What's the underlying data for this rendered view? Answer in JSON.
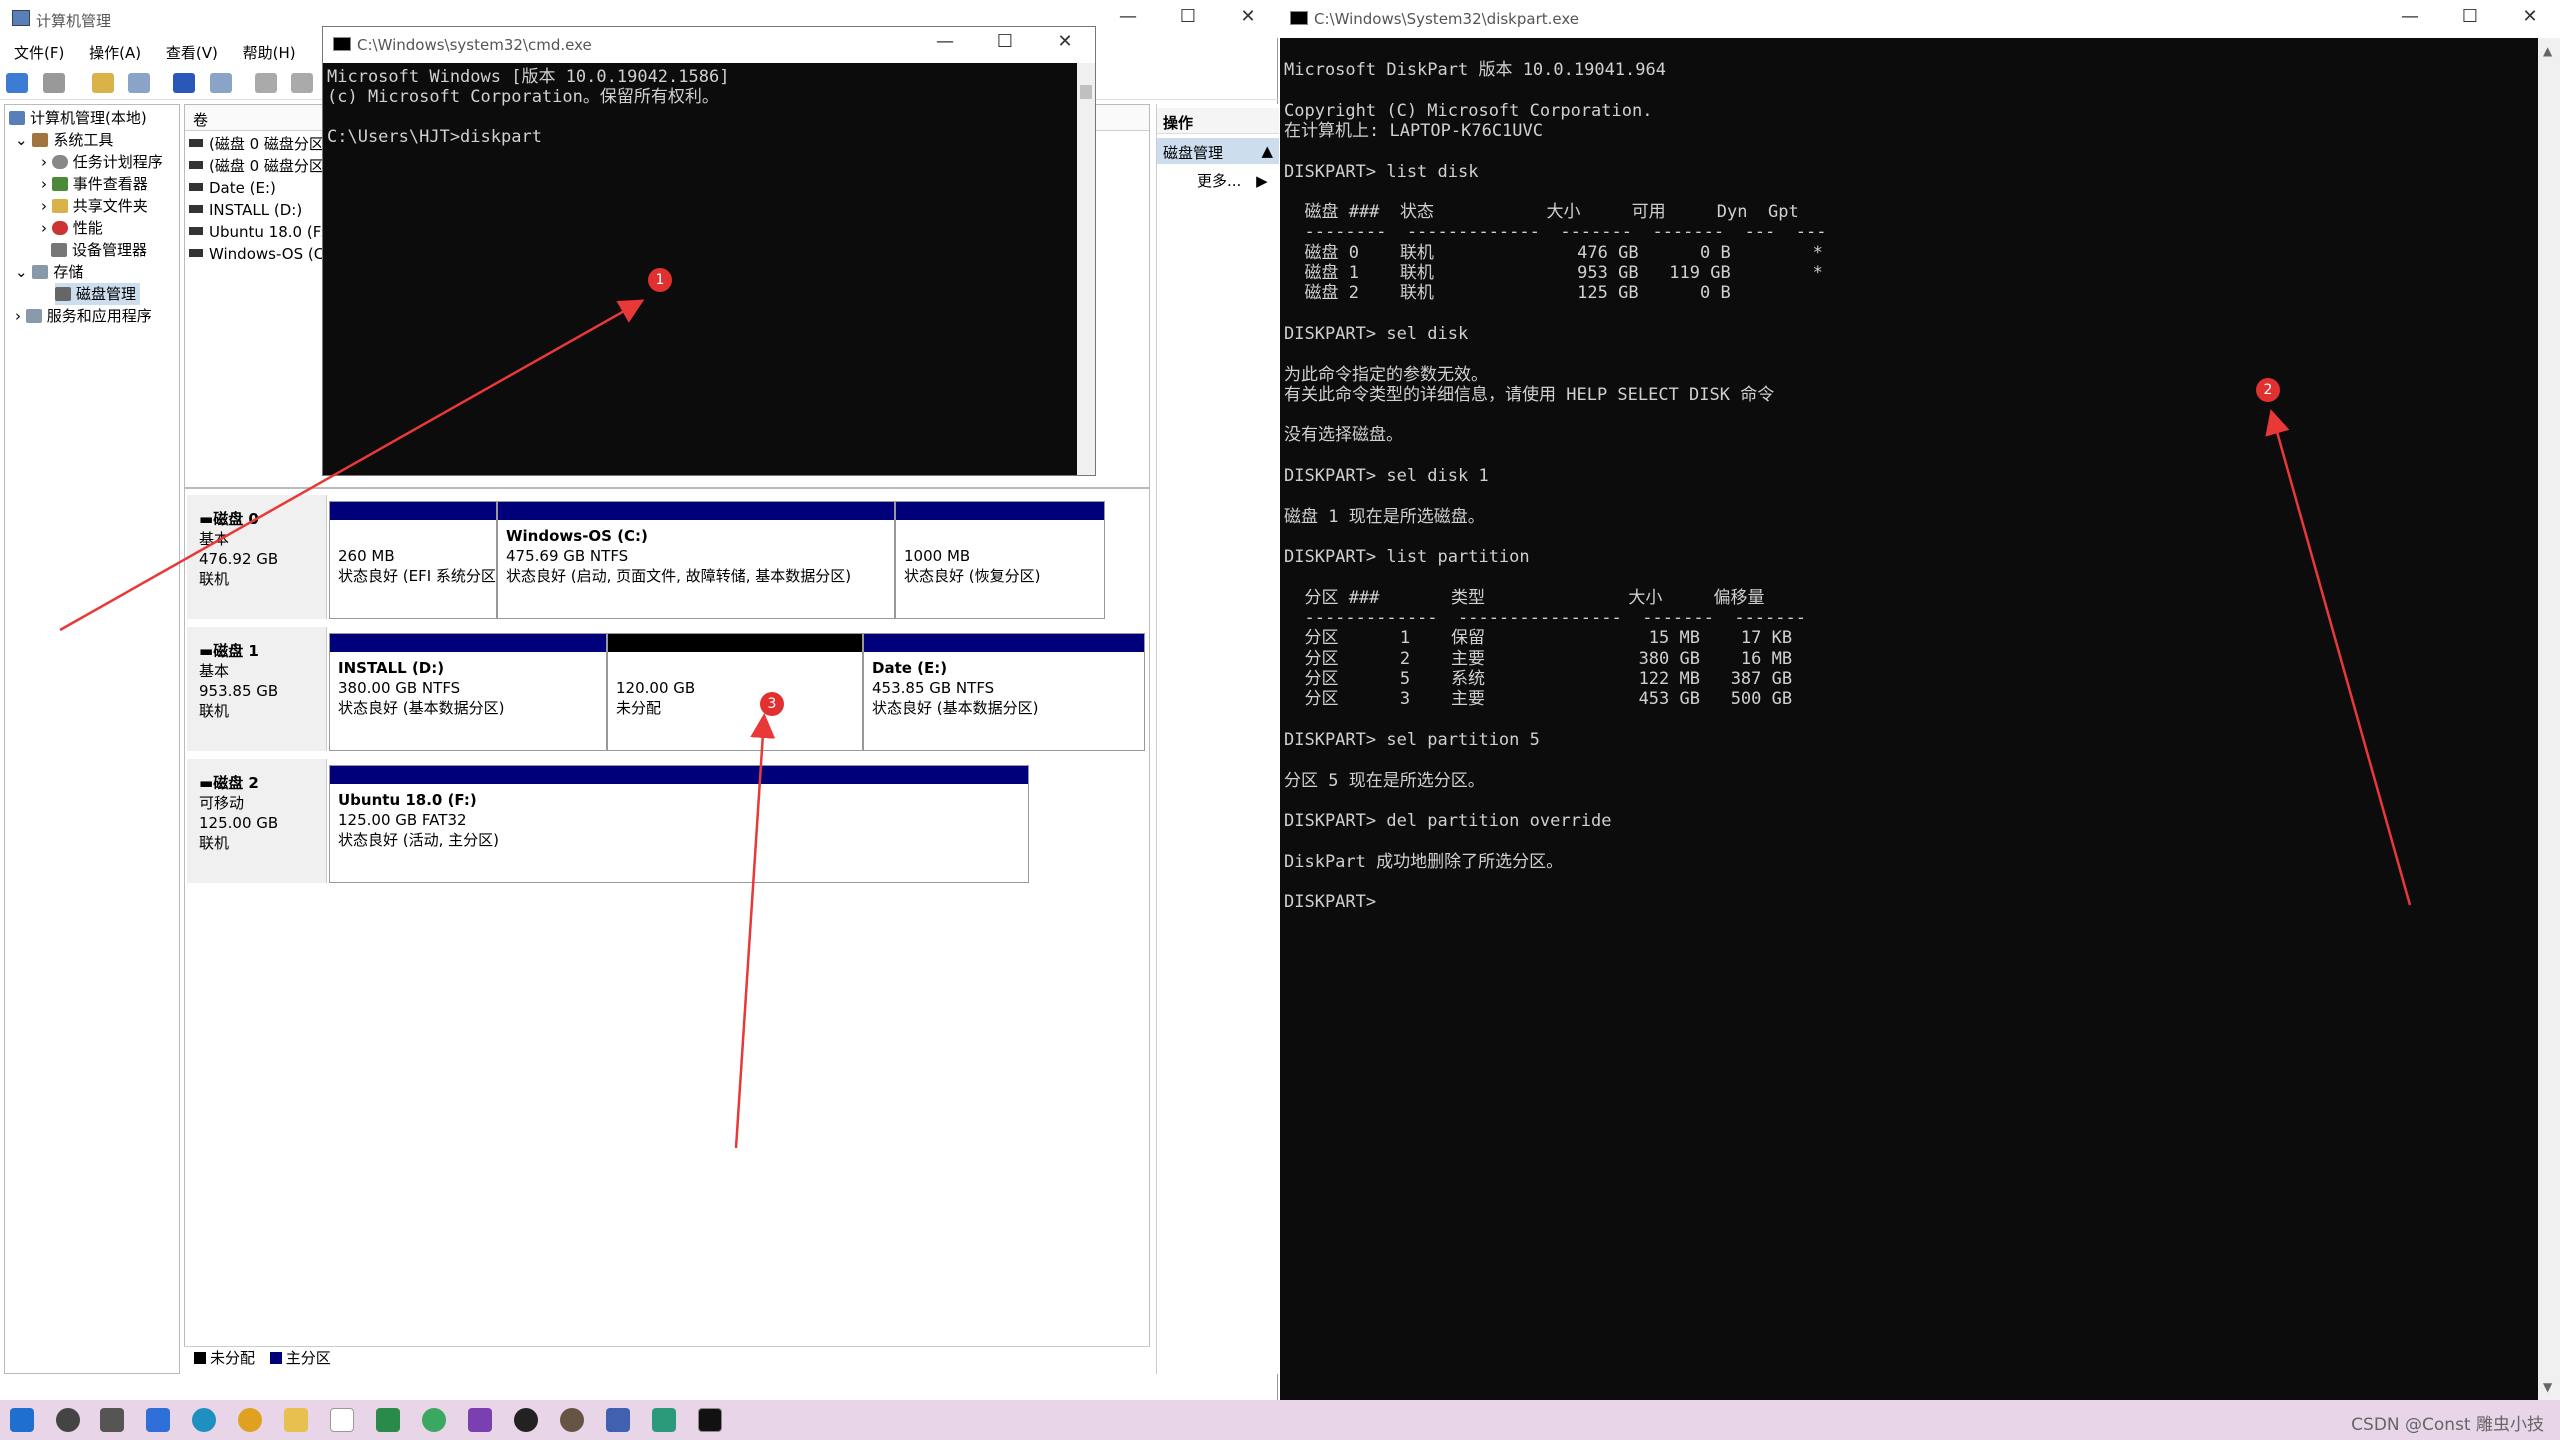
{
  "comp_mgmt": {
    "title": "计算机管理",
    "menu": [
      "文件(F)",
      "操作(A)",
      "查看(V)",
      "帮助(H)"
    ],
    "tree": [
      "计算机管理(本地)",
      "系统工具",
      "任务计划程序",
      "事件查看器",
      "共享文件夹",
      "性能",
      "设备管理器",
      "存储",
      "磁盘管理",
      "服务和应用程序"
    ],
    "vol_header": "卷",
    "volumes": [
      "(磁盘 0 磁盘分区",
      "(磁盘 0 磁盘分区",
      "Date (E:)",
      "INSTALL (D:)",
      "Ubuntu 18.0 (F:)",
      "Windows-OS (C"
    ],
    "disks": [
      {
        "name": "磁盘 0",
        "type": "基本",
        "size": "476.92 GB",
        "status": "联机",
        "parts": [
          {
            "size": "260 MB",
            "status": "状态良好 (EFI 系统分区)"
          },
          {
            "name": "Windows-OS  (C:)",
            "size": "475.69 GB NTFS",
            "status": "状态良好 (启动, 页面文件, 故障转储, 基本数据分区)"
          },
          {
            "size": "1000 MB",
            "status": "状态良好 (恢复分区)"
          }
        ]
      },
      {
        "name": "磁盘 1",
        "type": "基本",
        "size": "953.85 GB",
        "status": "联机",
        "parts": [
          {
            "name": "INSTALL  (D:)",
            "size": "380.00 GB NTFS",
            "status": "状态良好 (基本数据分区)"
          },
          {
            "size": "120.00 GB",
            "status": "未分配"
          },
          {
            "name": "Date  (E:)",
            "size": "453.85 GB NTFS",
            "status": "状态良好 (基本数据分区)"
          }
        ]
      },
      {
        "name": "磁盘 2",
        "type": "可移动",
        "size": "125.00 GB",
        "status": "联机",
        "parts": [
          {
            "name": "Ubuntu 18.0  (F:)",
            "size": "125.00 GB FAT32",
            "status": "状态良好 (活动, 主分区)"
          }
        ]
      }
    ],
    "legend": [
      "未分配",
      "主分区"
    ],
    "actions": {
      "header": "操作",
      "selected": "磁盘管理",
      "more": "更多..."
    }
  },
  "cmd": {
    "title": "C:\\Windows\\system32\\cmd.exe",
    "lines": [
      "Microsoft Windows [版本 10.0.19042.1586]",
      "(c) Microsoft Corporation。保留所有权利。",
      "",
      "C:\\Users\\HJT>diskpart"
    ]
  },
  "diskpart": {
    "title": "C:\\Windows\\System32\\diskpart.exe",
    "lines": [
      "Microsoft DiskPart 版本 10.0.19041.964",
      "",
      "Copyright (C) Microsoft Corporation.",
      "在计算机上: LAPTOP-K76C1UVC",
      "",
      "DISKPART> list disk",
      "",
      "  磁盘 ###  状态           大小     可用     Dyn  Gpt",
      "  --------  -------------  -------  -------  ---  ---",
      "  磁盘 0    联机              476 GB      0 B        *",
      "  磁盘 1    联机              953 GB   119 GB        *",
      "  磁盘 2    联机              125 GB      0 B",
      "",
      "DISKPART> sel disk",
      "",
      "为此命令指定的参数无效。",
      "有关此命令类型的详细信息，请使用 HELP SELECT DISK 命令",
      "",
      "没有选择磁盘。",
      "",
      "DISKPART> sel disk 1",
      "",
      "磁盘 1 现在是所选磁盘。",
      "",
      "DISKPART> list partition",
      "",
      "  分区 ###       类型              大小     偏移量",
      "  -------------  ----------------  -------  -------",
      "  分区      1    保留                15 MB    17 KB",
      "  分区      2    主要               380 GB    16 MB",
      "  分区      5    系统               122 MB   387 GB",
      "  分区      3    主要               453 GB   500 GB",
      "",
      "DISKPART> sel partition 5",
      "",
      "分区 5 现在是所选分区。",
      "",
      "DISKPART> del partition override",
      "",
      "DiskPart 成功地删除了所选分区。",
      "",
      "DISKPART>"
    ]
  },
  "markers": [
    "1",
    "2",
    "3"
  ],
  "watermark": "CSDN @Const 雕虫小技"
}
